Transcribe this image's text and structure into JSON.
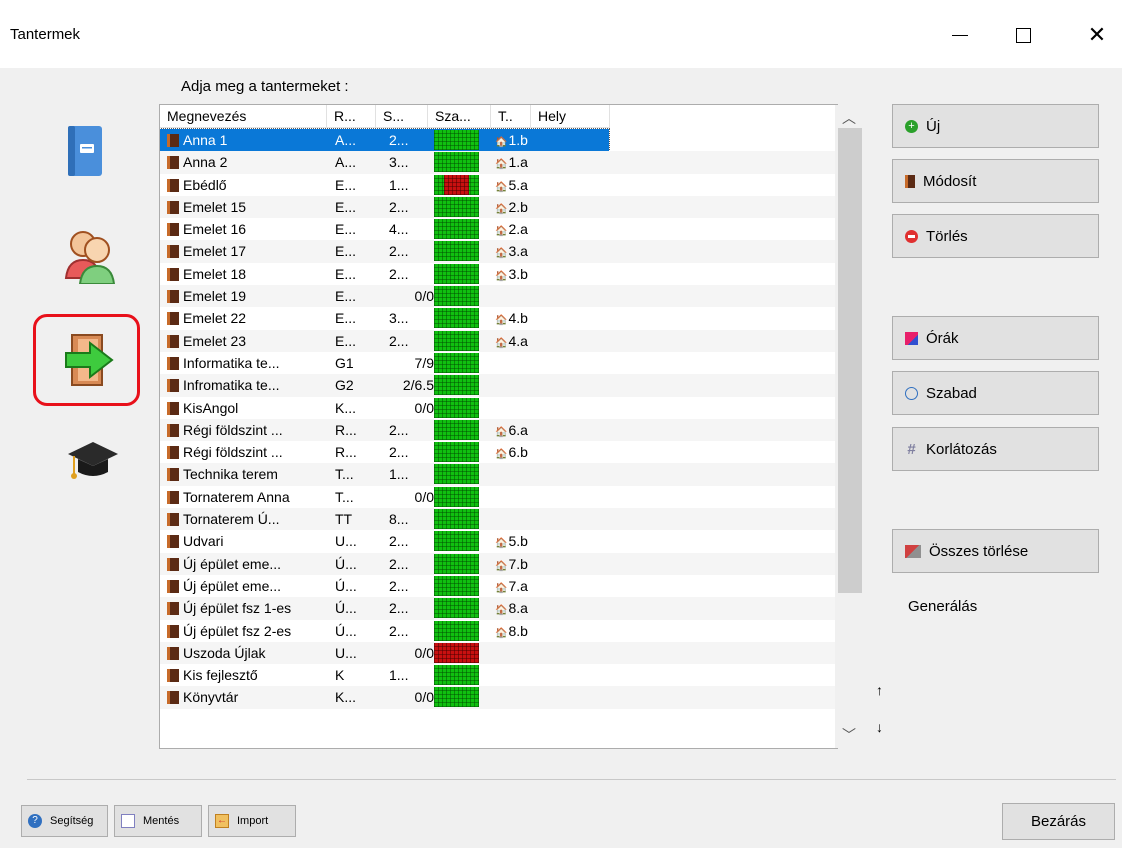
{
  "window": {
    "title": "Tantermek"
  },
  "prompt": "Adja meg a tantermeket :",
  "columns": [
    "Megnevezés",
    "R...",
    "S...",
    "Sza...",
    "T..",
    "Hely"
  ],
  "rows": [
    {
      "name": "Anna 1",
      "r": "A...",
      "s": "2...",
      "cls": "1.b",
      "busy": 0,
      "selected": true
    },
    {
      "name": "Anna 2",
      "r": "A...",
      "s": "3...",
      "cls": "1.a",
      "busy": 0
    },
    {
      "name": "Ebédlő",
      "r": "E...",
      "s": "1...",
      "cls": "5.a",
      "busy": 0.55
    },
    {
      "name": "Emelet 15",
      "r": "E...",
      "s": "2...",
      "cls": "2.b",
      "busy": 0
    },
    {
      "name": "Emelet 16",
      "r": "E...",
      "s": "4...",
      "cls": "2.a",
      "busy": 0
    },
    {
      "name": "Emelet 17",
      "r": "E...",
      "s": "2...",
      "cls": "3.a",
      "busy": 0
    },
    {
      "name": "Emelet 18",
      "r": "E...",
      "s": "2...",
      "cls": "3.b",
      "busy": 0
    },
    {
      "name": "Emelet 19",
      "r": "E...",
      "s": "0/0",
      "cls": "",
      "busy": 0
    },
    {
      "name": "Emelet 22",
      "r": "E...",
      "s": "3...",
      "cls": "4.b",
      "busy": 0
    },
    {
      "name": "Emelet 23",
      "r": "E...",
      "s": "2...",
      "cls": "4.a",
      "busy": 0
    },
    {
      "name": "Informatika te...",
      "r": "G1",
      "s": "7/9",
      "cls": "",
      "busy": 0
    },
    {
      "name": "Infromatika te...",
      "r": "G2",
      "s": "2/6.5",
      "cls": "",
      "busy": 0
    },
    {
      "name": "KisAngol",
      "r": "K...",
      "s": "0/0",
      "cls": "",
      "busy": 0
    },
    {
      "name": "Régi földszint ...",
      "r": "R...",
      "s": "2...",
      "cls": "6.a",
      "busy": 0
    },
    {
      "name": "Régi földszint ...",
      "r": "R...",
      "s": "2...",
      "cls": "6.b",
      "busy": 0
    },
    {
      "name": "Technika terem",
      "r": "T...",
      "s": "1...",
      "cls": "",
      "busy": 0
    },
    {
      "name": "Tornaterem Anna",
      "r": "T...",
      "s": "0/0",
      "cls": "",
      "busy": 0
    },
    {
      "name": "Tornaterem Ú...",
      "r": "TT",
      "s": "8...",
      "cls": "",
      "busy": 0
    },
    {
      "name": "Udvari",
      "r": "U...",
      "s": "2...",
      "cls": "5.b",
      "busy": 0
    },
    {
      "name": "Új épület eme...",
      "r": "Ú...",
      "s": "2...",
      "cls": "7.b",
      "busy": 0
    },
    {
      "name": "Új épület eme...",
      "r": "Ú...",
      "s": "2...",
      "cls": "7.a",
      "busy": 0
    },
    {
      "name": "Új épület fsz 1-es",
      "r": "Ú...",
      "s": "2...",
      "cls": "8.a",
      "busy": 0
    },
    {
      "name": "Új épület fsz 2-es",
      "r": "Ú...",
      "s": "2...",
      "cls": "8.b",
      "busy": 0
    },
    {
      "name": "Uszoda Újlak",
      "r": "U...",
      "s": "0/0",
      "cls": "",
      "busy": 1
    },
    {
      "name": "Kis fejlesztő",
      "r": "K",
      "s": "1...",
      "cls": "",
      "busy": 0
    },
    {
      "name": "Könyvtár",
      "r": "K...",
      "s": "0/0",
      "cls": "",
      "busy": 0
    }
  ],
  "buttons": {
    "new": "Új",
    "modify": "Módosít",
    "delete": "Törlés",
    "hours": "Órák",
    "free": "Szabad",
    "limit": "Korlátozás",
    "delete_all": "Összes törlése",
    "generate": "Generálás",
    "help": "Segítség",
    "save": "Mentés",
    "import": "Import",
    "close": "Bezárás"
  },
  "arrows": {
    "up": "↑",
    "down": "↓"
  },
  "colors": {
    "selection": "#0a78d7",
    "free": "#10c010",
    "busy": "#c81010",
    "highlight": "#e8101a"
  },
  "icons": [
    "book-icon",
    "people-icon",
    "door-arrow-icon",
    "graduation-cap-icon"
  ]
}
